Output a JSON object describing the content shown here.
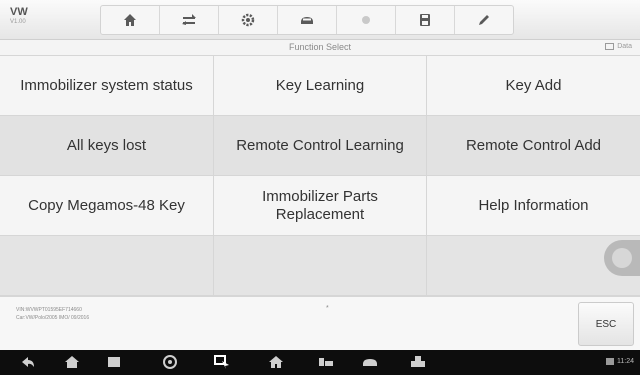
{
  "app": {
    "brand": "VW",
    "brand_sub": "V1.00"
  },
  "toolbar": {
    "buttons": [
      {
        "name": "home",
        "icon": "home-icon"
      },
      {
        "name": "vehicle-swap",
        "icon": "vehicle-swap-icon"
      },
      {
        "name": "settings",
        "icon": "gear-icon"
      },
      {
        "name": "vehicle-info",
        "icon": "car-icon"
      },
      {
        "name": "record",
        "icon": "circle-icon"
      },
      {
        "name": "save",
        "icon": "save-icon"
      },
      {
        "name": "edit",
        "icon": "pen-icon"
      }
    ]
  },
  "header": {
    "title": "Function Select",
    "right_label": "Data"
  },
  "functions": [
    "Immobilizer system status",
    "Key Learning",
    "Key Add",
    "All keys lost",
    "Remote Control Learning",
    "Remote Control Add",
    "Copy Megamos-48 Key",
    "Immobilizer Parts Replacement",
    "Help Information"
  ],
  "info": {
    "vin_line1": "VIN:WVWPT01595EF714660",
    "vin_line2": "Car:VW/Polo/2005 IMO/ 09/2016",
    "marker": "*"
  },
  "esc_label": "ESC",
  "navbar": {
    "icons": [
      "back-icon",
      "home-icon",
      "recent-apps-icon",
      "browser-icon",
      "screen-switch-icon",
      "house-icon",
      "vehicle-icon",
      "car-icon",
      "vci-icon"
    ],
    "status": "11:24"
  },
  "colors": {
    "row_light": "#f5f5f5",
    "row_dark": "#e2e2e2",
    "toolbar_icon": "#5a5a5a",
    "navbar": "#0d0d0d"
  }
}
